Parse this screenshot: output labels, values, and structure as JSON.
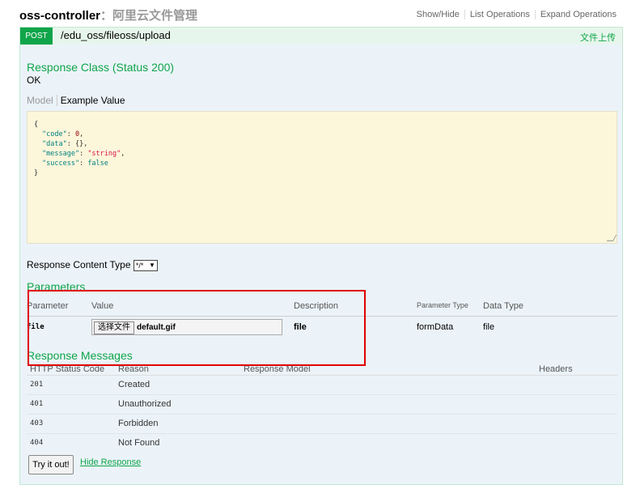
{
  "header": {
    "controller": "oss-controller",
    "separator": "：",
    "description": "阿里云文件管理",
    "ops": [
      "Show/Hide",
      "List Operations",
      "Expand Operations"
    ]
  },
  "operation": {
    "method": "POST",
    "path": "/edu_oss/fileoss/upload",
    "summary": "文件上传"
  },
  "response_class": {
    "title": "Response Class (Status 200)",
    "status_text": "OK",
    "tab_model": "Model",
    "tab_example": "Example Value"
  },
  "example_json": {
    "open": "{",
    "close": "}",
    "lines": [
      {
        "key": "\"code\"",
        "value": "0",
        "type": "number",
        "comma": ","
      },
      {
        "key": "\"data\"",
        "value": "{}",
        "type": "plain",
        "comma": ","
      },
      {
        "key": "\"message\"",
        "value": "\"string\"",
        "type": "string",
        "comma": ","
      },
      {
        "key": "\"success\"",
        "value": "false",
        "type": "bool",
        "comma": ""
      }
    ]
  },
  "content_type": {
    "label": "Response Content Type",
    "selected": "*/*"
  },
  "parameters": {
    "title": "Parameters",
    "headers": {
      "parameter": "Parameter",
      "value": "Value",
      "description": "Description",
      "param_type": "Parameter Type",
      "data_type": "Data Type"
    },
    "rows": [
      {
        "name": "file",
        "choose_button": "选择文件",
        "chosen_file": "default.gif",
        "description": "file",
        "param_type": "formData",
        "data_type": "file"
      }
    ]
  },
  "response_messages": {
    "title": "Response Messages",
    "headers": {
      "code": "HTTP Status Code",
      "reason": "Reason",
      "model": "Response Model",
      "headers": "Headers"
    },
    "rows": [
      {
        "code": "201",
        "reason": "Created"
      },
      {
        "code": "401",
        "reason": "Unauthorized"
      },
      {
        "code": "403",
        "reason": "Forbidden"
      },
      {
        "code": "404",
        "reason": "Not Found"
      }
    ]
  },
  "actions": {
    "try_it": "Try it out!",
    "hide_response": "Hide Response"
  },
  "colors": {
    "post_green": "#10a54a",
    "op_bg": "#ebf3f9",
    "json_bg": "#fcf6db",
    "highlight_red": "#e00000"
  }
}
